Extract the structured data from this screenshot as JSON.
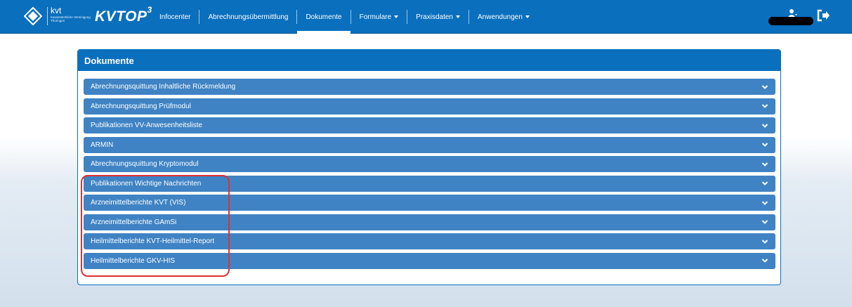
{
  "brand": {
    "short": "kvt",
    "subtitle": "Kassenärztliche Vereinigung Thüringen",
    "product": "KVTOP",
    "product_sup": "3"
  },
  "nav": {
    "items": [
      {
        "label": "Infocenter",
        "active": false,
        "dropdown": false
      },
      {
        "label": "Abrechnungsübermittlung",
        "active": false,
        "dropdown": false
      },
      {
        "label": "Dokumente",
        "active": true,
        "dropdown": false
      },
      {
        "label": "Formulare",
        "active": false,
        "dropdown": true
      },
      {
        "label": "Praxisdaten",
        "active": false,
        "dropdown": true
      },
      {
        "label": "Anwendungen",
        "active": false,
        "dropdown": true
      }
    ],
    "user_icon": "user-icon",
    "logout_icon": "logout-icon"
  },
  "panel": {
    "title": "Dokumente",
    "items": [
      {
        "label": "Abrechnungsquittung Inhaltliche Rückmeldung"
      },
      {
        "label": "Abrechnungsquittung Prüfmodul"
      },
      {
        "label": "Publikationen VV-Anwesenheitsliste"
      },
      {
        "label": "ARMIN"
      },
      {
        "label": "Abrechnungsquittung Kryptomodul"
      },
      {
        "label": "Publikationen Wichtige Nachrichten"
      },
      {
        "label": "Arzneimittelberichte KVT (VIS)"
      },
      {
        "label": "Arzneimittelberichte GAmSi"
      },
      {
        "label": "Heilmittelberichte KVT-Heilmittel-Report"
      },
      {
        "label": "Heilmittelberichte GKV-HIS"
      }
    ]
  },
  "colors": {
    "navbar": "#0a6fbd",
    "accordion": "#3f83c4",
    "highlight": "#e03030"
  }
}
